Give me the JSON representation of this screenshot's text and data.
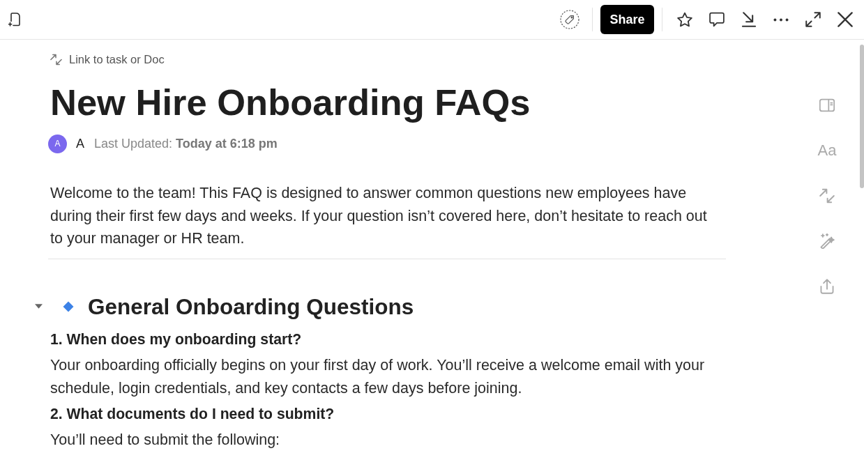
{
  "toolbar": {
    "share_button": "Share"
  },
  "document": {
    "link_action": "Link to task or Doc",
    "title": "New Hire Onboarding FAQs",
    "author": {
      "avatar_initial": "A",
      "name": "A",
      "last_updated": "Last Updated: **Today at 6:18 pm**"
    },
    "intro": "Welcome to the team! This FAQ is designed to answer common questions new employees have during their first few days and weeks. If your question isn’t covered here, don’t hesitate to reach out to your manager or HR team.",
    "sections": [
      {
        "heading": "General Onboarding Questions",
        "expanded": true,
        "items": [
          {
            "kind": "question",
            "text": "1. When does my onboarding start?"
          },
          {
            "kind": "answer",
            "text": "Your onboarding officially begins on your first day of work. You’ll receive a welcome email with your schedule, login credentials, and key contacts a few days before joining."
          },
          {
            "kind": "question",
            "text": "2. What documents do I need to submit?"
          },
          {
            "kind": "answer",
            "text": "You’ll need to submit the following:"
          }
        ]
      }
    ]
  },
  "right_rail": {
    "font_button": "Aa"
  }
}
